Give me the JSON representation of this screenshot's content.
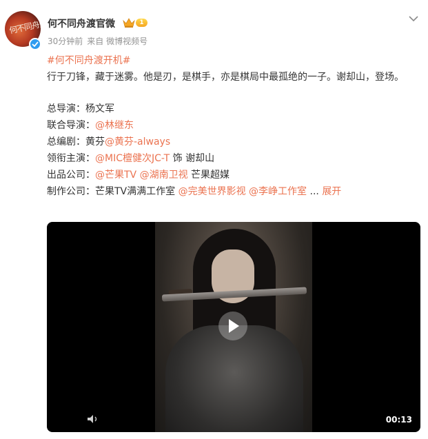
{
  "header": {
    "username": "何不同舟渡官微",
    "vip_level": "1",
    "time": "30分钟前",
    "source": "来自 微博视频号"
  },
  "post": {
    "hashtag": "#何不同舟渡开机#",
    "body": "行于刀锋，藏于迷雾。他是刃，是棋手，亦是棋局中最孤绝的一子。谢却山，登场。",
    "credits": {
      "director_label": "总导演：",
      "director": "杨文军",
      "co_director_label": "联合导演：",
      "co_director": "@林继东",
      "writer_label": "总编剧：",
      "writer": "黄芬",
      "writer_mention": "@黄芬-always",
      "lead_label": "领衔主演：",
      "lead_mention": "@MIC檀健次JC-T",
      "lead_role": " 饰 谢却山",
      "producer_label": "出品公司：",
      "producer_mention_1": "@芒果TV",
      "producer_mention_2": "@湖南卫视",
      "producer_plain": " 芒果超媒",
      "production_label": "制作公司：",
      "production_plain": "芒果TV满满工作室 ",
      "production_mention_1": "@完美世界影视",
      "production_mention_2": "@李峥工作室",
      "ellipsis": "  ... ",
      "expand": "展开"
    }
  },
  "video": {
    "duration": "00:13"
  },
  "icons": {
    "avatar_badge": "verified-icon",
    "vip": "crown-icon",
    "menu": "chevron-down-icon",
    "play": "play-icon",
    "volume": "volume-icon"
  },
  "colors": {
    "accent": "#eb7350",
    "verified": "#2f9cf0",
    "meta": "#939393"
  }
}
